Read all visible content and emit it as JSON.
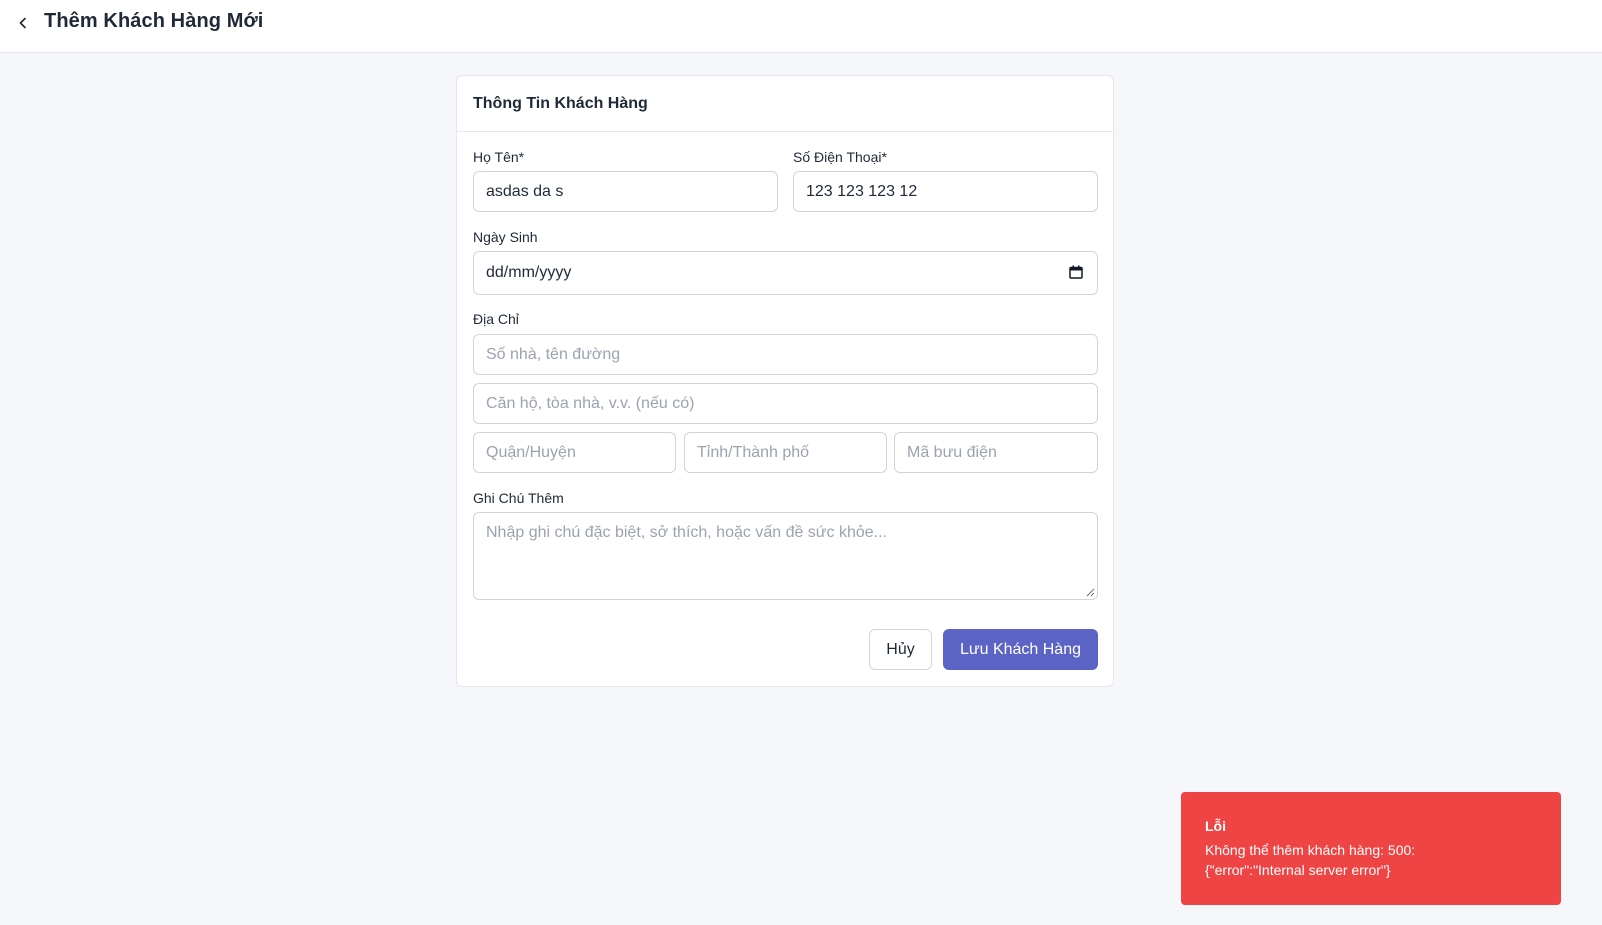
{
  "header": {
    "title": "Thêm Khách Hàng Mới",
    "back_icon": "chevron-left-icon"
  },
  "card": {
    "title": "Thông Tin Khách Hàng",
    "name": {
      "label": "Họ Tên*",
      "value": "asdas da s"
    },
    "phone": {
      "label": "Số Điện Thoại*",
      "value": "123 123 123 12"
    },
    "dob": {
      "label": "Ngày Sinh",
      "value": "dd/mm/yyyy",
      "icon": "calendar-icon"
    },
    "address": {
      "label": "Địa Chỉ",
      "street_placeholder": "Số nhà, tên đường",
      "apartment_placeholder": "Căn hộ, tòa nhà, v.v. (nếu có)",
      "district_placeholder": "Quận/Huyện",
      "city_placeholder": "Tỉnh/Thành phố",
      "postal_placeholder": "Mã bưu điện"
    },
    "notes": {
      "label": "Ghi Chú Thêm",
      "placeholder": "Nhập ghi chú đặc biệt, sở thích, hoặc vấn đề sức khỏe..."
    },
    "cancel_label": "Hủy",
    "save_label": "Lưu Khách Hàng"
  },
  "toast": {
    "title": "Lỗi",
    "message": "Không thể thêm khách hàng: 500: {\"error\":\"Internal server error\"}"
  },
  "colors": {
    "primary": "#5b63c4",
    "error": "#ef4444",
    "background": "#f6f7fb"
  }
}
